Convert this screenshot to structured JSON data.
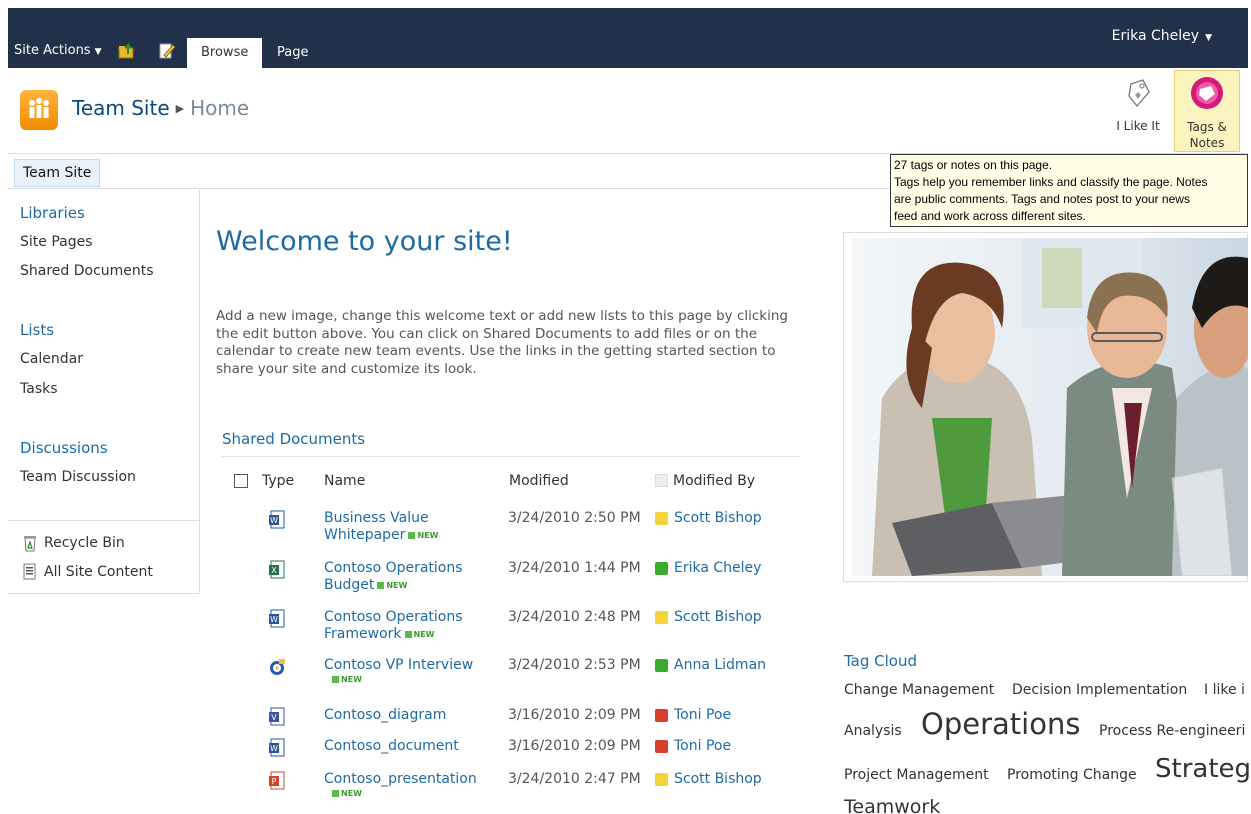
{
  "ribbon": {
    "site_actions": "Site Actions",
    "tabs": [
      "Browse",
      "Page"
    ],
    "user": "Erika Cheley"
  },
  "title": {
    "site": "Team Site",
    "page": "Home"
  },
  "social": {
    "like": "I Like It",
    "tags_line1": "Tags &",
    "tags_line2": "Notes"
  },
  "topnav": {
    "tab": "Team Site"
  },
  "tooltip": {
    "lines": [
      "27 tags or notes on this page.",
      "Tags help you remember links and classify the page.  Notes",
      "are public comments.  Tags and notes post to your news",
      "feed and work across different sites."
    ]
  },
  "leftnav": {
    "libraries": "Libraries",
    "site_pages": "Site Pages",
    "shared_documents": "Shared Documents",
    "lists": "Lists",
    "calendar": "Calendar",
    "tasks": "Tasks",
    "discussions": "Discussions",
    "team_discussion": "Team Discussion",
    "recycle_bin": "Recycle Bin",
    "all_site_content": "All Site Content"
  },
  "main": {
    "welcome": "Welcome to your site!",
    "intro": "Add a new image, change this welcome text or add new lists to this page by clicking the edit button above. You can click on Shared Documents to add files or on the calendar to create new team events. Use the links in the getting started section to share your site and customize its look."
  },
  "shared_docs": {
    "title": "Shared Documents",
    "columns": {
      "type": "Type",
      "name": "Name",
      "modified": "Modified",
      "modified_by": "Modified By"
    },
    "new_label": "NEW",
    "rows": [
      {
        "icon": "word-doc-icon",
        "name_l1": "Business Value",
        "name_l2": "Whitepaper",
        "new": true,
        "modified": "3/24/2010 2:50 PM",
        "by": "Scott Bishop",
        "presence": "#f3d23a"
      },
      {
        "icon": "excel-doc-icon",
        "name_l1": "Contoso Operations",
        "name_l2": "Budget",
        "new": true,
        "modified": "3/24/2010 1:44 PM",
        "by": "Erika Cheley",
        "presence": "#3aaa2c"
      },
      {
        "icon": "word-doc-icon",
        "name_l1": "Contoso Operations",
        "name_l2": "Framework",
        "new": true,
        "modified": "3/24/2010 2:48 PM",
        "by": "Scott Bishop",
        "presence": "#f3d23a"
      },
      {
        "icon": "video-icon",
        "name_l1": "Contoso VP Interview",
        "name_l2": "",
        "new": true,
        "modified": "3/24/2010 2:53 PM",
        "by": "Anna Lidman",
        "presence": "#3aaa2c"
      },
      {
        "icon": "visio-doc-icon",
        "name_l1": "Contoso_diagram",
        "name_l2": "",
        "new": false,
        "modified": "3/16/2010 2:09 PM",
        "by": "Toni Poe",
        "presence": "#d8402e"
      },
      {
        "icon": "word-doc-icon",
        "name_l1": "Contoso_document",
        "name_l2": "",
        "new": false,
        "modified": "3/16/2010 2:09 PM",
        "by": "Toni Poe",
        "presence": "#d8402e"
      },
      {
        "icon": "powerpoint-doc-icon",
        "name_l1": "Contoso_presentation",
        "name_l2": "",
        "new": true,
        "modified": "3/24/2010 2:47 PM",
        "by": "Scott Bishop",
        "presence": "#f3d23a"
      }
    ]
  },
  "tag_cloud": {
    "title": "Tag Cloud",
    "tags": [
      "Change Management",
      "Decision Implementation",
      "I like i",
      "Analysis",
      "Operations",
      "Process Re-engineeri",
      "Project Management",
      "Promoting Change",
      "Strateg",
      "Teamwork"
    ]
  },
  "colors": {
    "ribbon_bg": "#21314a",
    "link_blue": "#1d6aa5",
    "tooltip_bg": "#ffffe6",
    "tags_highlight": "#fcf4bf"
  }
}
